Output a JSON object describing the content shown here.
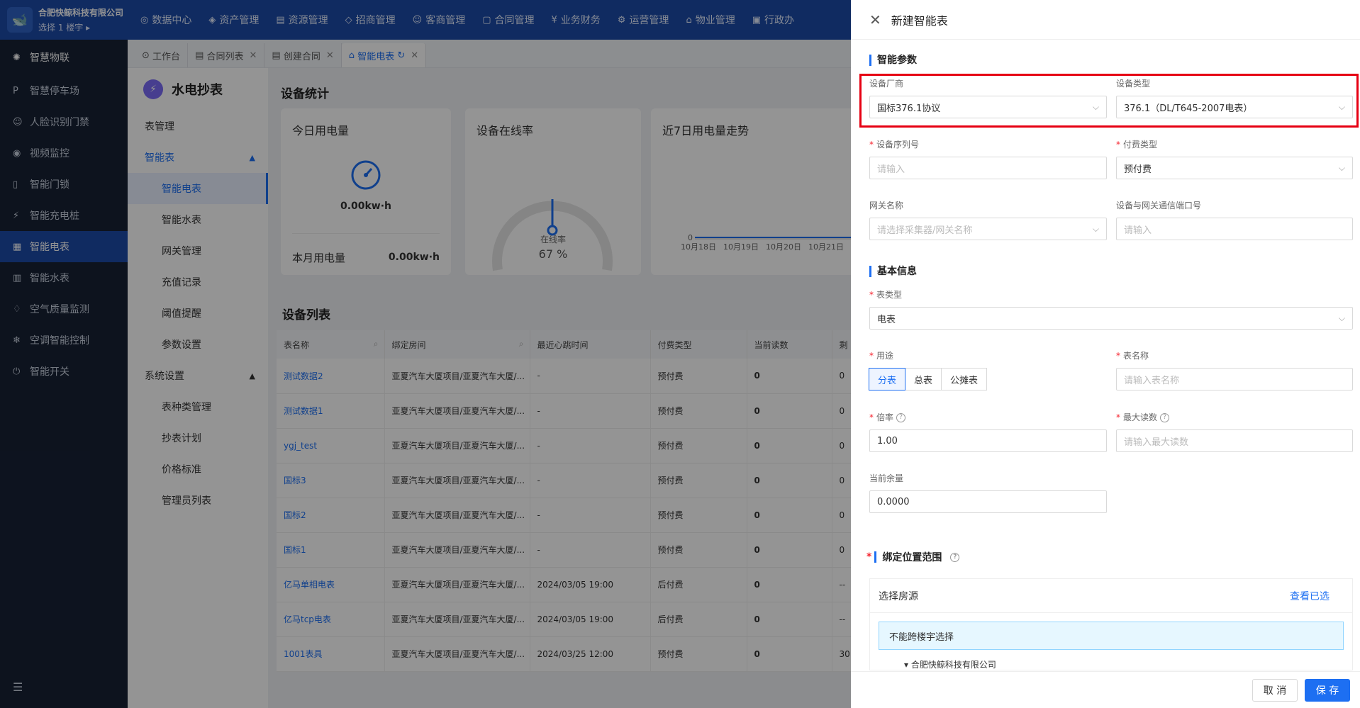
{
  "app": {
    "company": "合肥快鲸科技有限公司",
    "building_select": "选择 1 楼宇"
  },
  "topnav": [
    {
      "icon": "◎",
      "label": "数据中心"
    },
    {
      "icon": "◈",
      "label": "资产管理"
    },
    {
      "icon": "▤",
      "label": "资源管理"
    },
    {
      "icon": "◇",
      "label": "招商管理"
    },
    {
      "icon": "☺",
      "label": "客商管理"
    },
    {
      "icon": "▢",
      "label": "合同管理"
    },
    {
      "icon": "¥",
      "label": "业务财务"
    },
    {
      "icon": "⚙",
      "label": "运营管理"
    },
    {
      "icon": "⌂",
      "label": "物业管理"
    },
    {
      "icon": "▣",
      "label": "行政办"
    }
  ],
  "sidebar": {
    "header": "智慧物联",
    "items": [
      {
        "icon": "P",
        "label": "智慧停车场"
      },
      {
        "icon": "☺",
        "label": "人脸识别门禁"
      },
      {
        "icon": "◉",
        "label": "视频监控"
      },
      {
        "icon": "▯",
        "label": "智能门锁"
      },
      {
        "icon": "⚡",
        "label": "智能充电桩"
      },
      {
        "icon": "▦",
        "label": "智能电表"
      },
      {
        "icon": "▥",
        "label": "智能水表"
      },
      {
        "icon": "♢",
        "label": "空气质量监测"
      },
      {
        "icon": "❄",
        "label": "空调智能控制"
      },
      {
        "icon": "⏻",
        "label": "智能开关"
      }
    ],
    "collapse_icon": "☰"
  },
  "tabs": [
    {
      "label": "工作台",
      "icon": "⊙",
      "closable": false
    },
    {
      "label": "合同列表",
      "icon": "▤",
      "closable": true
    },
    {
      "label": "创建合同",
      "icon": "▤",
      "closable": true
    },
    {
      "label": "智能电表",
      "icon": "⌂",
      "closable": true
    }
  ],
  "subnav": {
    "title": "水电抄表",
    "items": [
      {
        "label": "表管理",
        "kind": "top"
      },
      {
        "label": "智能表",
        "kind": "group"
      },
      {
        "label": "智能电表",
        "kind": "child"
      },
      {
        "label": "智能水表",
        "kind": "child"
      },
      {
        "label": "网关管理",
        "kind": "child"
      },
      {
        "label": "充值记录",
        "kind": "child"
      },
      {
        "label": "阈值提醒",
        "kind": "child"
      },
      {
        "label": "参数设置",
        "kind": "child"
      },
      {
        "label": "系统设置",
        "kind": "section"
      },
      {
        "label": "表种类管理",
        "kind": "child"
      },
      {
        "label": "抄表计划",
        "kind": "child"
      },
      {
        "label": "价格标准",
        "kind": "child"
      },
      {
        "label": "管理员列表",
        "kind": "child"
      }
    ]
  },
  "stats": {
    "section_title": "设备统计",
    "today": {
      "title": "今日用电量",
      "value": "0.00kw·h"
    },
    "month": {
      "label": "本月用电量",
      "value": "0.00kw·h"
    },
    "online": {
      "title": "设备在线率",
      "label": "在线率",
      "value": "67 %",
      "fraction": 0.67
    },
    "trend": {
      "title": "近7日用电量走势"
    }
  },
  "chart_data": {
    "type": "line",
    "title": "近7日用电量走势",
    "categories": [
      "10月18日",
      "10月19日",
      "10月20日",
      "10月21日"
    ],
    "series": [
      {
        "values": [
          0,
          0,
          0,
          0
        ]
      }
    ],
    "ytick": "0"
  },
  "table": {
    "section_title": "设备列表",
    "columns": [
      "表名称",
      "绑定房间",
      "最近心跳时间",
      "付费类型",
      "当前读数",
      "剩"
    ],
    "rows": [
      [
        "测试数据2",
        "亚夏汽车大厦项目/亚夏汽车大厦/...",
        "-",
        "预付费",
        "0",
        "0"
      ],
      [
        "测试数据1",
        "亚夏汽车大厦项目/亚夏汽车大厦/...",
        "-",
        "预付费",
        "0",
        "0"
      ],
      [
        "ygj_test",
        "亚夏汽车大厦项目/亚夏汽车大厦/...",
        "-",
        "预付费",
        "0",
        "0"
      ],
      [
        "国标3",
        "亚夏汽车大厦项目/亚夏汽车大厦/...",
        "-",
        "预付费",
        "0",
        "0"
      ],
      [
        "国标2",
        "亚夏汽车大厦项目/亚夏汽车大厦/...",
        "-",
        "预付费",
        "0",
        "0"
      ],
      [
        "国标1",
        "亚夏汽车大厦项目/亚夏汽车大厦/...",
        "-",
        "预付费",
        "0",
        "0"
      ],
      [
        "亿马单相电表",
        "亚夏汽车大厦项目/亚夏汽车大厦/...",
        "2024/03/05 19:00",
        "后付费",
        "0",
        "--"
      ],
      [
        "亿马tcp电表",
        "亚夏汽车大厦项目/亚夏汽车大厦/...",
        "2024/03/05 19:00",
        "后付费",
        "0",
        "--"
      ],
      [
        "1001表具",
        "亚夏汽车大厦项目/亚夏汽车大厦/...",
        "2024/03/25 12:00",
        "预付费",
        "0",
        "30."
      ]
    ]
  },
  "drawer": {
    "title": "新建智能表",
    "close_icon": "✕",
    "group_params": "智能参数",
    "vendor": {
      "label": "设备厂商",
      "value": "国标376.1协议"
    },
    "device_type": {
      "label": "设备类型",
      "value": "376.1（DL/T645-2007电表）"
    },
    "serial": {
      "label": "设备序列号",
      "placeholder": "请输入"
    },
    "pay_type": {
      "label": "付费类型",
      "value": "预付费"
    },
    "gateway": {
      "label": "网关名称",
      "placeholder": "请选择采集器/网关名称"
    },
    "port": {
      "label": "设备与网关通信端口号",
      "placeholder": "请输入"
    },
    "group_basic": "基本信息",
    "meter_type": {
      "label": "表类型",
      "value": "电表"
    },
    "usage": {
      "label": "用途",
      "options": [
        "分表",
        "总表",
        "公摊表"
      ],
      "selected": "分表"
    },
    "meter_name": {
      "label": "表名称",
      "placeholder": "请输入表名称"
    },
    "ratio": {
      "label": "倍率",
      "value": "1.00"
    },
    "max_reading": {
      "label": "最大读数",
      "placeholder": "请输入最大读数"
    },
    "balance": {
      "label": "当前余量",
      "value": "0.0000"
    },
    "bind_title": "绑定位置范围",
    "room_select": "选择房源",
    "view_selected": "查看已选",
    "notice": "不能跨楼宇选择",
    "tree_partial": "合肥快鲸科技有限公司",
    "cancel": "取 消",
    "save": "保 存"
  },
  "colors": {
    "primary": "#1d6ff2",
    "topbar": "#1d4aa8",
    "sidebar": "#172135",
    "highlight": "#e60012"
  }
}
